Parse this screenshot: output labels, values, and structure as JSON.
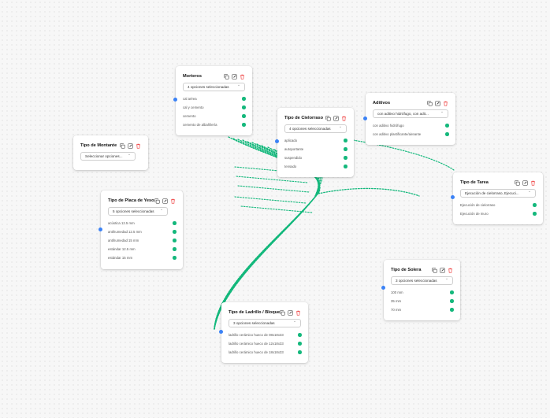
{
  "colors": {
    "edge": "#14b87c",
    "port_in": "#3b82f6",
    "delete": "#ef4444",
    "tool": "#555555"
  },
  "icons": {
    "duplicate": "copy-icon",
    "edit": "edit-icon",
    "delete": "trash-icon",
    "select": "chevron-updown-icon"
  },
  "nodes": {
    "morteros": {
      "title": "Morteros",
      "select": "4 opciones seleccionadas",
      "options": [
        "cal aérea",
        "cal y cemento",
        "cemento",
        "cemento de albañilería"
      ]
    },
    "aditivos": {
      "title": "Aditivos",
      "select": "con aditivo hidrófugo, con adit...",
      "options": [
        "con aditivo hidrófugo",
        "con aditivo plastificante/aireante"
      ]
    },
    "cielorraso": {
      "title": "Tipo de Cielorraso",
      "select": "4 opciones seleccionadas",
      "options": [
        "aplicado",
        "autoportante",
        "suspendido",
        "tensado"
      ]
    },
    "montante": {
      "title": "Tipo de Montante",
      "select": "Seleccionar opciones..."
    },
    "placa": {
      "title": "Tipo de Placa de Yeso",
      "select": "5 opciones seleccionadas",
      "options": [
        "acústica 12.5 mm",
        "antihumedad 12.5 mm",
        "antihumedad 15 mm",
        "estándar 12.5 mm",
        "estándar 15 mm"
      ]
    },
    "tarea": {
      "title": "Tipo de Tarea",
      "select": "Ejecución de cielorraso, Ejecuci...",
      "options": [
        "Ejecución de cielorraso",
        "Ejecución de muro"
      ]
    },
    "solera": {
      "title": "Tipo de Solera",
      "select": "3 opciones seleccionadas",
      "options": [
        "100 mm",
        "35 mm",
        "70 mm"
      ]
    },
    "ladrillo": {
      "title": "Tipo de Ladrillo / Bloque",
      "select": "3 opciones seleccionadas",
      "options": [
        "ladrillo cerámico hueco de 08x18x33",
        "ladrillo cerámico hueco de 12x18x33",
        "ladrillo cerámico hueco de 18x18x33"
      ]
    }
  }
}
